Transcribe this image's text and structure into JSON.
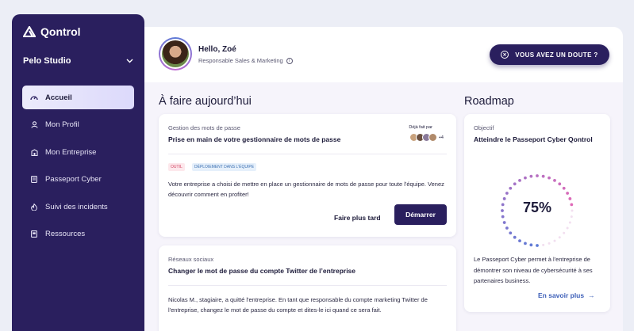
{
  "sidebar": {
    "brand": "Qontrol",
    "org": "Pelo Studio",
    "items": [
      {
        "label": "Accueil",
        "icon": "speedometer-icon",
        "active": true
      },
      {
        "label": "Mon Profil",
        "icon": "user-icon",
        "active": false
      },
      {
        "label": "Mon Entreprise",
        "icon": "building-icon",
        "active": false
      },
      {
        "label": "Passeport Cyber",
        "icon": "passport-icon",
        "active": false
      },
      {
        "label": "Suivi des incidents",
        "icon": "fire-icon",
        "active": false
      },
      {
        "label": "Ressources",
        "icon": "book-icon",
        "active": false
      }
    ]
  },
  "header": {
    "greeting": "Hello, Zoé",
    "role": "Responsable Sales & Marketing",
    "doubt_button": "VOUS AVEZ UN DOUTE ?"
  },
  "todo": {
    "title": "À faire aujourd’hui",
    "cards": [
      {
        "category": "Gestion des mots de passe",
        "title": "Prise en main de votre gestionnaire de mots de passe",
        "done_by_label": "Déjà fait par",
        "done_by_more": "+4",
        "tags": [
          "OUTIL",
          "DÉPLOIEMENT DANS L'ÉQUIPE"
        ],
        "body": "Votre entreprise a choisi de mettre en place un gestionnaire de mots de passe pour toute l'équipe. Venez découvrir comment en profiter!",
        "later_label": "Faire plus tard",
        "start_label": "Démarrer"
      },
      {
        "category": "Réseaux sociaux",
        "title": "Changer le mot de passe du compte Twitter de l’entreprise",
        "body": "Nicolas M., stagiaire, a quitté l'entreprise. En tant que responsable du compte marketing Twitter de l'entreprise, changez le mot de passe du compte et dites-le ici quand ce sera fait."
      }
    ]
  },
  "roadmap": {
    "title": "Roadmap",
    "objective_label": "Objectif",
    "objective": "Atteindre le Passeport Cyber Qontrol",
    "progress_text": "75%",
    "progress": 0.75,
    "description": "Le Passeport Cyber permet à l'entreprise de démontrer son niveau de cybersécurité à ses partenaires business.",
    "learn_more": "En savoir plus",
    "learn_more_arrow": "→"
  },
  "colors": {
    "sidebar": "#2a1f5e",
    "accent": "#2a1f5e",
    "link": "#3d5fb8",
    "gauge_start": "#5d7bd6",
    "gauge_end": "#e06bb8"
  }
}
